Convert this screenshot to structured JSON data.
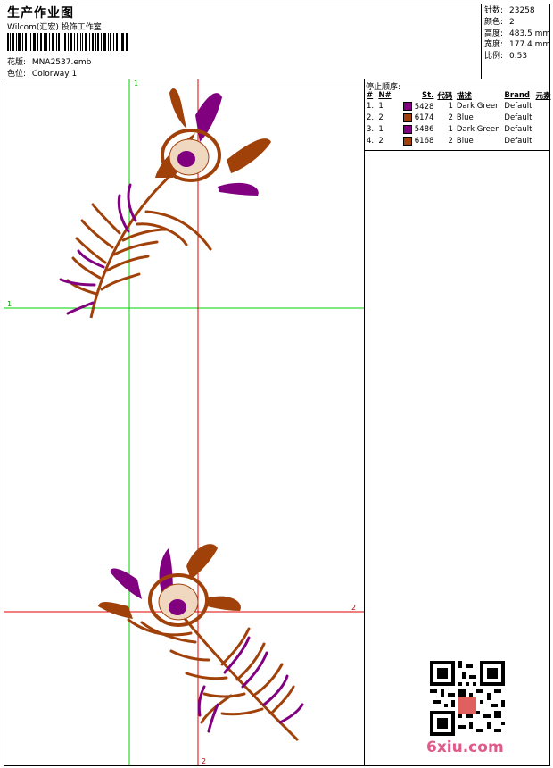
{
  "header": {
    "title": "生产作业图",
    "company": "Wilcom(汇宏) 投饰工作室",
    "design_label": "花版:",
    "design_value": "MNA2537.emb",
    "colorway_label": "色位:",
    "colorway_value": "Colorway 1"
  },
  "stats": [
    {
      "label": "针数:",
      "value": "23258"
    },
    {
      "label": "颜色:",
      "value": "2"
    },
    {
      "label": "高度:",
      "value": "483.5 mm"
    },
    {
      "label": "宽度:",
      "value": "177.4 mm"
    },
    {
      "label": "比例:",
      "value": "0.53"
    }
  ],
  "stop_sequence": {
    "title": "停止顺序:",
    "headers": {
      "num": "#",
      "n": "N#",
      "st": "St.",
      "code": "代码",
      "desc": "描述",
      "brand": "Brand",
      "elem": "元素"
    },
    "rows": [
      {
        "num": "1.",
        "n": "1",
        "color": "#800080",
        "st": "5428",
        "code": "1",
        "desc": "Dark Green",
        "brand": "Default"
      },
      {
        "num": "2.",
        "n": "2",
        "color": "#a0410a",
        "st": "6174",
        "code": "2",
        "desc": "Blue",
        "brand": "Default"
      },
      {
        "num": "3.",
        "n": "1",
        "color": "#800080",
        "st": "5486",
        "code": "1",
        "desc": "Dark Green",
        "brand": "Default"
      },
      {
        "num": "4.",
        "n": "2",
        "color": "#a0410a",
        "st": "6168",
        "code": "2",
        "desc": "Blue",
        "brand": "Default"
      }
    ]
  },
  "canvas": {
    "axis_labels": {
      "top_v1": "1",
      "left_h1": "1",
      "right_h2": "2",
      "bottom_v2": "2"
    },
    "axis_colors": {
      "green": "#00d000",
      "red": "#e00000"
    }
  },
  "watermark": {
    "site": "6xiu.com"
  }
}
